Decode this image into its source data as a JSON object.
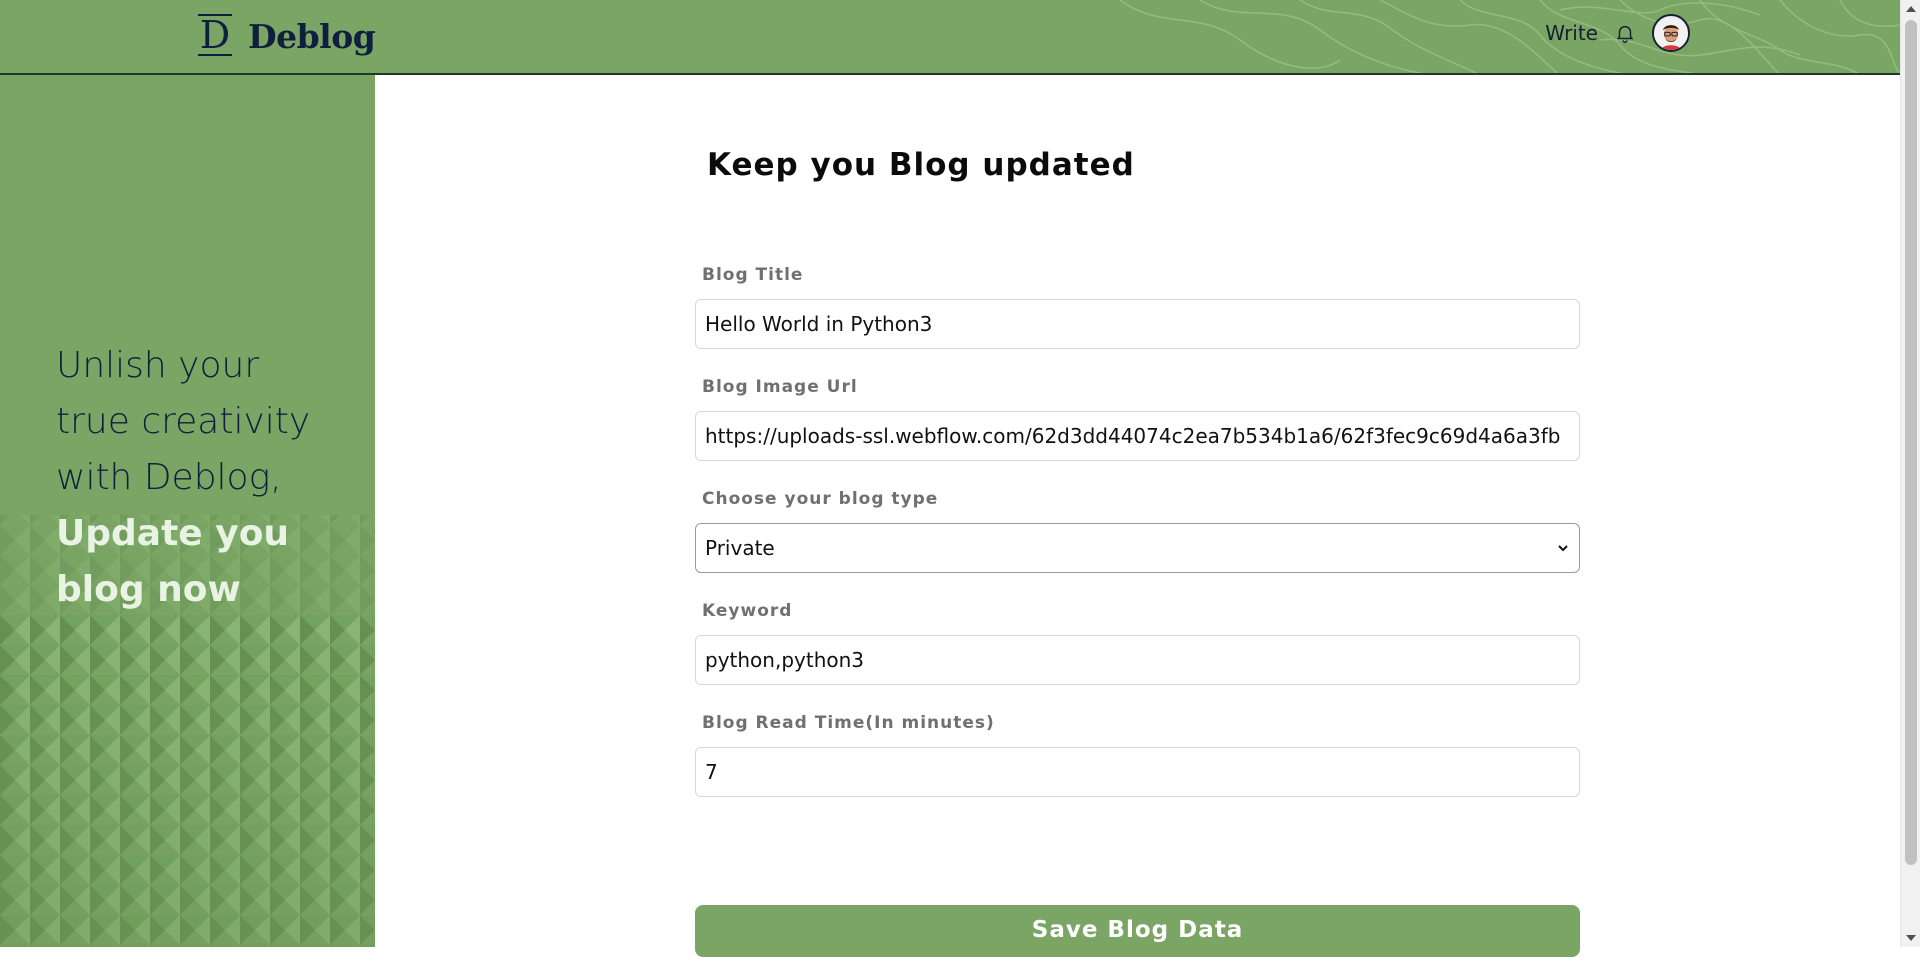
{
  "header": {
    "logo_mark": "D",
    "logo_text": "Deblog",
    "write_label": "Write",
    "bell_icon": "bell-icon",
    "avatar_icon": "avatar"
  },
  "sidebar": {
    "tagline_lines": [
      "Unlish your",
      "true creativity",
      "with Deblog,"
    ],
    "tagline_bold_lines": [
      "Update you",
      "blog now"
    ]
  },
  "main": {
    "title": "Keep you Blog updated",
    "fields": {
      "blog_title": {
        "label": "Blog Title",
        "value": "Hello World in Python3"
      },
      "blog_image_url": {
        "label": "Blog Image Url",
        "value": "https://uploads-ssl.webflow.com/62d3dd44074c2ea7b534b1a6/62f3fec9c69d4a6a3fb"
      },
      "blog_type": {
        "label": "Choose your blog type",
        "value": "Private"
      },
      "keyword": {
        "label": "Keyword",
        "value": "python,python3"
      },
      "read_time": {
        "label": "Blog Read Time(In minutes)",
        "value": "7"
      }
    },
    "save_label": "Save Blog Data"
  },
  "colors": {
    "brand_green": "#7ba565",
    "navy": "#0f1f3d"
  }
}
